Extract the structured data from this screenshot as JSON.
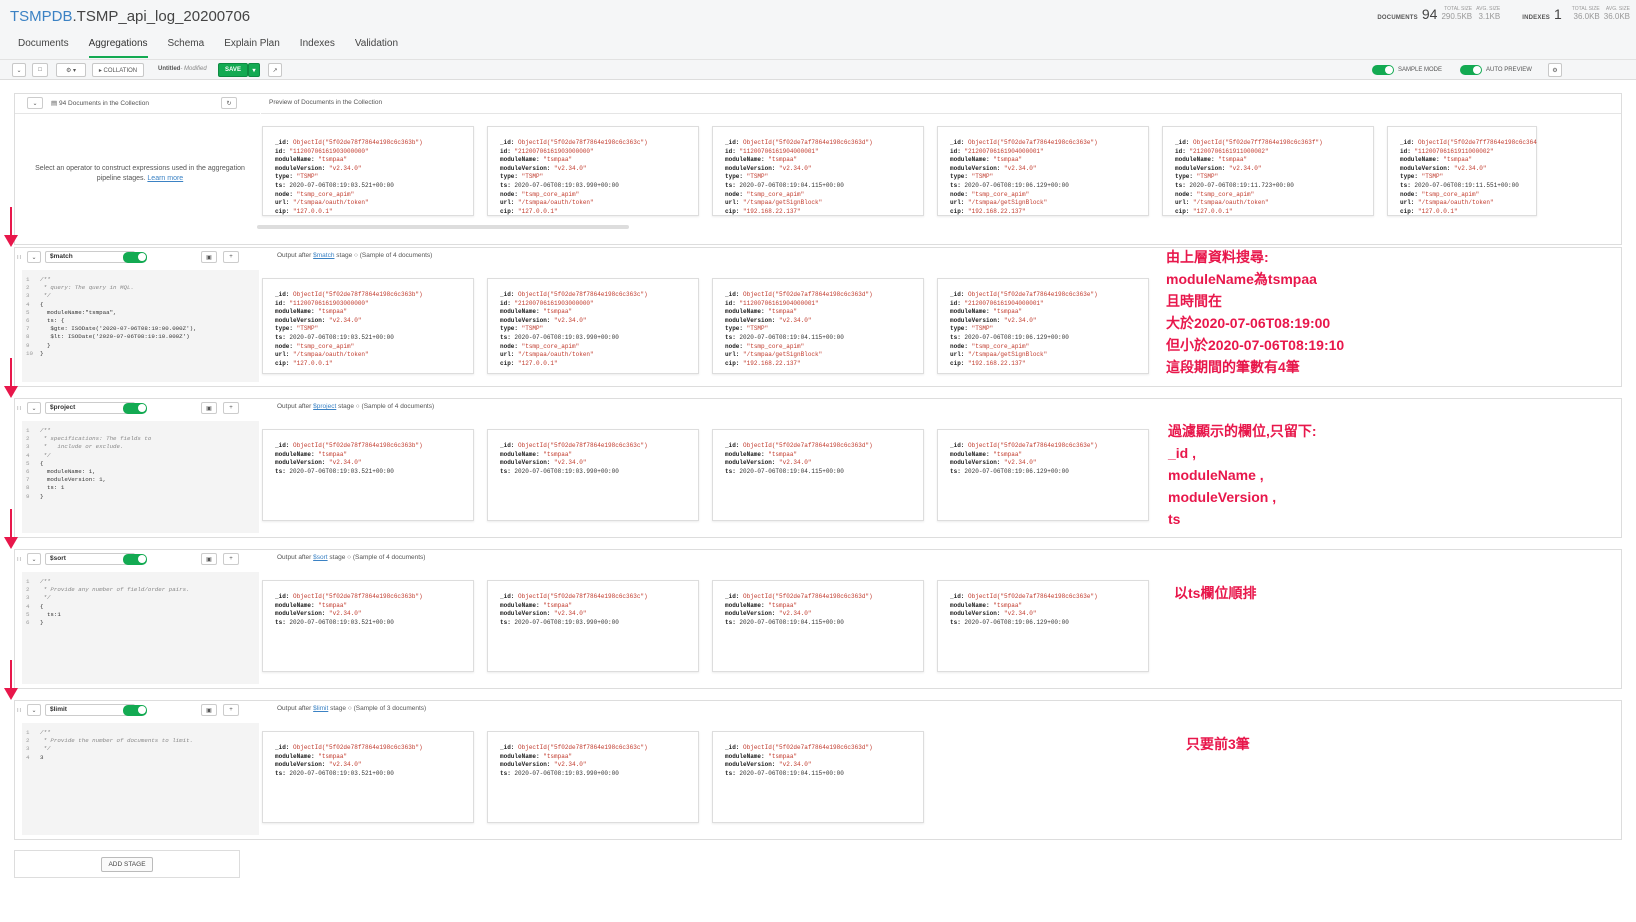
{
  "header": {
    "db": "TSMPDB",
    "collection": ".TSMP_api_log_20200706",
    "documents_label": "DOCUMENTS",
    "documents_count": "94",
    "total_size_label": "TOTAL SIZE",
    "total_size": "290.5KB",
    "avg_size_label": "AVG. SIZE",
    "avg_size": "3.1KB",
    "indexes_label": "INDEXES",
    "indexes_count": "1",
    "idx_total_size_label": "TOTAL SIZE",
    "idx_total_size": "36.0KB",
    "idx_avg_size_label": "AVG. SIZE",
    "idx_avg_size": "36.0KB"
  },
  "tabs": [
    "Documents",
    "Aggregations",
    "Schema",
    "Explain Plan",
    "Indexes",
    "Validation"
  ],
  "toolbar": {
    "collation": "▸ COLLATION",
    "pipeline_name": "Untitled",
    "modified": "- Modified",
    "save": "SAVE",
    "sample_mode": "SAMPLE MODE",
    "auto_preview": "AUTO PREVIEW"
  },
  "collection_panel": {
    "count_text": "94 Documents in the Collection",
    "preview_text": "Preview of Documents in the Collection",
    "hint": "Select an operator to construct expressions used in the aggregation pipeline stages.",
    "learn_more": "Learn more"
  },
  "preview_docs": [
    {
      "oid": "ObjectId(\"5f02de78f7864e198c6c363b\")",
      "id": "\"11200706161903000000\"",
      "moduleName": "\"tsmpaa\"",
      "moduleVersion": "\"v2.34.0\"",
      "type": "\"TSMP\"",
      "ts": "2020-07-06T08:19:03.521+00:00",
      "node": "\"tsmp_core_apim\"",
      "url": "\"/tsmpaa/oauth/token\"",
      "cip": "\"127.0.0.1\""
    },
    {
      "oid": "ObjectId(\"5f02de78f7864e198c6c363c\")",
      "id": "\"21200706161903000000\"",
      "moduleName": "\"tsmpaa\"",
      "moduleVersion": "\"v2.34.0\"",
      "type": "\"TSMP\"",
      "ts": "2020-07-06T08:19:03.990+00:00",
      "node": "\"tsmp_core_apim\"",
      "url": "\"/tsmpaa/oauth/token\"",
      "cip": "\"127.0.0.1\""
    },
    {
      "oid": "ObjectId(\"5f02de7af7864e198c6c363d\")",
      "id": "\"11200706161904000001\"",
      "moduleName": "\"tsmpaa\"",
      "moduleVersion": "\"v2.34.0\"",
      "type": "\"TSMP\"",
      "ts": "2020-07-06T08:19:04.115+00:00",
      "node": "\"tsmp_core_apim\"",
      "url": "\"/tsmpaa/getSignBlock\"",
      "cip": "\"192.168.22.137\""
    },
    {
      "oid": "ObjectId(\"5f02de7af7864e198c6c363e\")",
      "id": "\"21200706161904000001\"",
      "moduleName": "\"tsmpaa\"",
      "moduleVersion": "\"v2.34.0\"",
      "type": "\"TSMP\"",
      "ts": "2020-07-06T08:19:06.129+00:00",
      "node": "\"tsmp_core_apim\"",
      "url": "\"/tsmpaa/getSignBlock\"",
      "cip": "\"192.168.22.137\""
    },
    {
      "oid": "ObjectId(\"5f02de7ff7864e198c6c363f\")",
      "id": "\"21200706161911000002\"",
      "moduleName": "\"tsmpaa\"",
      "moduleVersion": "\"v2.34.0\"",
      "type": "\"TSMP\"",
      "ts": "2020-07-06T08:19:11.723+00:00",
      "node": "\"tsmp_core_apim\"",
      "url": "\"/tsmpaa/oauth/token\"",
      "cip": "\"127.0.0.1\""
    },
    {
      "oid": "ObjectId(\"5f02de7ff7864e198c6c364",
      "id": "\"11200706161911000002\"",
      "moduleName": "\"tsmpaa\"",
      "moduleVersion": "\"v2.34.0\"",
      "type": "\"TSMP\"",
      "ts": "2020-07-06T08:19:11.551+00:00",
      "node": "\"tsmp_core_apim\"",
      "url": "\"/tsmpaa/oauth/token\"",
      "cip": "\"127.0.0.1\""
    }
  ],
  "stages": [
    {
      "operator": "$match",
      "output_label": "Output after",
      "output_op": "$match",
      "output_suffix": "stage",
      "sample_text": "(Sample of 4 documents)",
      "code": [
        "/**",
        " * query: The query in MQL.",
        " */",
        "{",
        "  moduleName:\"tsmpaa\",",
        "  ts: {",
        "   $gte: ISODate('2020-07-06T08:19:00.000Z'),",
        "   $lt: ISODate('2020-07-06T08:19:10.000Z')",
        "  }",
        "}"
      ],
      "annotation": [
        "由上層資料搜尋:",
        "moduleName為tsmpaa",
        "且時間在",
        "大於2020-07-06T08:19:00",
        "但小於2020-07-06T08:19:10",
        "這段期間的筆數有4筆"
      ]
    },
    {
      "operator": "$project",
      "output_label": "Output after",
      "output_op": "$project",
      "output_suffix": "stage",
      "sample_text": "(Sample of 4 documents)",
      "code": [
        "/**",
        " * specifications: The fields to",
        " *   include or exclude.",
        " */",
        "{",
        "  moduleName: 1,",
        "  moduleVersion: 1,",
        "  ts: 1",
        "}"
      ],
      "annotation": [
        "過濾顯示的欄位,只留下:",
        "_id ,",
        "moduleName ,",
        "moduleVersion ,",
        "ts"
      ]
    },
    {
      "operator": "$sort",
      "output_label": "Output after",
      "output_op": "$sort",
      "output_suffix": "stage",
      "sample_text": "(Sample of 4 documents)",
      "code": [
        "/**",
        " * Provide any number of field/order pairs.",
        " */",
        "{",
        "  ts:1",
        "}"
      ],
      "annotation": [
        "以ts欄位順排"
      ]
    },
    {
      "operator": "$limit",
      "output_label": "Output after",
      "output_op": "$limit",
      "output_suffix": "stage",
      "sample_text": "(Sample of 3 documents)",
      "code": [
        "/**",
        " * Provide the number of documents to limit.",
        " */",
        "3"
      ],
      "annotation": [
        "只要前3筆"
      ]
    }
  ],
  "add_stage": "ADD STAGE",
  "colors": {
    "accent": "#13aa52",
    "annotation": "#e8174b",
    "link": "#3b82c4"
  }
}
